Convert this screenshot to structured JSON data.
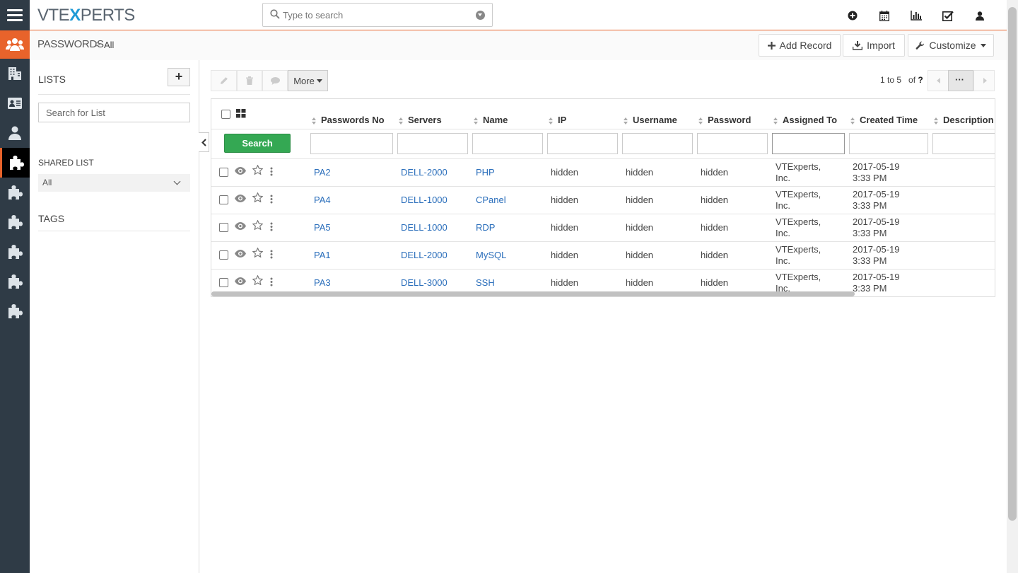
{
  "header": {
    "logo_left": "VTE",
    "logo_x": "X",
    "logo_right": "PERTS",
    "search_placeholder": "Type to search"
  },
  "breadcrumb": {
    "module": "PASSWORDS",
    "separator": ">",
    "view": "All"
  },
  "actions": {
    "add_record": "Add Record",
    "import": "Import",
    "customize": "Customize"
  },
  "sidebar": {
    "lists_heading": "LISTS",
    "add_label": "+",
    "list_search_placeholder": "Search for List",
    "shared_heading": "SHARED LIST",
    "shared_selected": "All",
    "tags_heading": "TAGS"
  },
  "toolbar": {
    "more_label": "More",
    "pager_text": "1 to 5",
    "pager_of": "of",
    "pager_total": "?",
    "dots": "···"
  },
  "table": {
    "search_button": "Search",
    "columns": [
      "Passwords No",
      "Servers",
      "Name",
      "IP",
      "Username",
      "Password",
      "Assigned To",
      "Created Time",
      "Description"
    ],
    "rows": [
      {
        "no": "PA2",
        "server": "DELL-2000",
        "name": "PHP",
        "ip": "hidden",
        "username": "hidden",
        "password": "hidden",
        "assigned_1": "VTExperts,",
        "assigned_2": "Inc.",
        "created_1": "2017-05-19",
        "created_2": "3:33 PM"
      },
      {
        "no": "PA4",
        "server": "DELL-1000",
        "name": "CPanel",
        "ip": "hidden",
        "username": "hidden",
        "password": "hidden",
        "assigned_1": "VTExperts,",
        "assigned_2": "Inc.",
        "created_1": "2017-05-19",
        "created_2": "3:33 PM"
      },
      {
        "no": "PA5",
        "server": "DELL-1000",
        "name": "RDP",
        "ip": "hidden",
        "username": "hidden",
        "password": "hidden",
        "assigned_1": "VTExperts,",
        "assigned_2": "Inc.",
        "created_1": "2017-05-19",
        "created_2": "3:33 PM"
      },
      {
        "no": "PA1",
        "server": "DELL-2000",
        "name": "MySQL",
        "ip": "hidden",
        "username": "hidden",
        "password": "hidden",
        "assigned_1": "VTExperts,",
        "assigned_2": "Inc.",
        "created_1": "2017-05-19",
        "created_2": "3:33 PM"
      },
      {
        "no": "PA3",
        "server": "DELL-3000",
        "name": "SSH",
        "ip": "hidden",
        "username": "hidden",
        "password": "hidden",
        "assigned_1": "VTExperts,",
        "assigned_2": "Inc.",
        "created_1": "2017-05-19",
        "created_2": "3:33 PM"
      }
    ]
  },
  "colors": {
    "accent": "#e8632b",
    "rail": "#2f3b46",
    "link": "#2a6ebb",
    "search_button": "#34a853"
  }
}
